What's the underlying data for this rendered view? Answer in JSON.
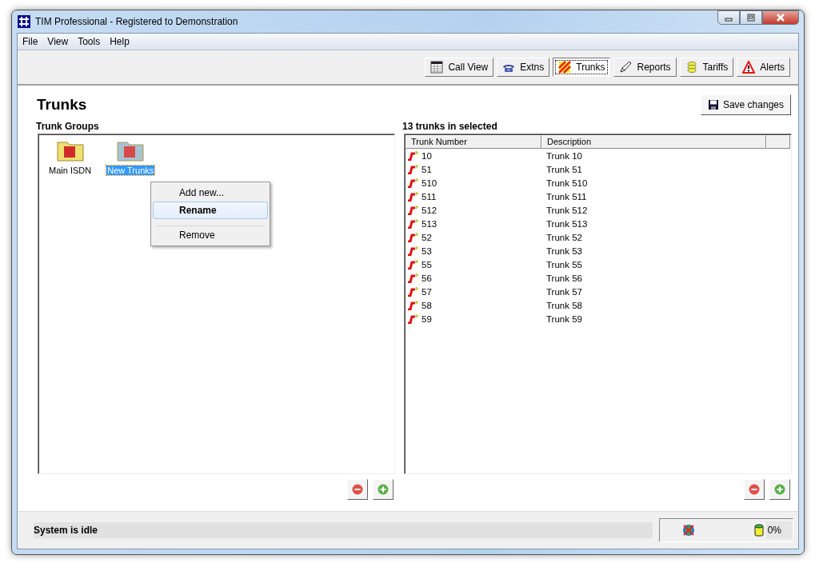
{
  "window": {
    "title": "TIM Professional - Registered to Demonstration"
  },
  "menu": [
    "File",
    "View",
    "Tools",
    "Help"
  ],
  "toolbar": [
    {
      "label": "Call View",
      "selected": false
    },
    {
      "label": "Extns",
      "selected": false
    },
    {
      "label": "Trunks",
      "selected": true
    },
    {
      "label": "Reports",
      "selected": false
    },
    {
      "label": "Tariffs",
      "selected": false
    },
    {
      "label": "Alerts",
      "selected": false
    }
  ],
  "page": {
    "title": "Trunks",
    "save_button": "Save changes"
  },
  "trunk_groups": {
    "heading": "Trunk Groups",
    "items": [
      {
        "label": "Main ISDN",
        "selected": false
      },
      {
        "label": "New Trunks",
        "selected": true
      }
    ]
  },
  "context_menu": [
    {
      "label": "Add new...",
      "selected": false,
      "separator_before": false
    },
    {
      "label": "Rename",
      "selected": true,
      "separator_before": false
    },
    {
      "label": "Remove",
      "selected": false,
      "separator_before": true
    }
  ],
  "trunks": {
    "heading": "13 trunks in selected",
    "columns": [
      "Trunk Number",
      "Description"
    ],
    "rows": [
      [
        "10",
        "Trunk 10"
      ],
      [
        "51",
        "Trunk 51"
      ],
      [
        "510",
        "Trunk 510"
      ],
      [
        "511",
        "Trunk 511"
      ],
      [
        "512",
        "Trunk 512"
      ],
      [
        "513",
        "Trunk 513"
      ],
      [
        "52",
        "Trunk 52"
      ],
      [
        "53",
        "Trunk 53"
      ],
      [
        "55",
        "Trunk 55"
      ],
      [
        "56",
        "Trunk 56"
      ],
      [
        "57",
        "Trunk 57"
      ],
      [
        "58",
        "Trunk 58"
      ],
      [
        "59",
        "Trunk 59"
      ]
    ]
  },
  "status_bar": {
    "message": "System is idle",
    "usage": "0%"
  }
}
